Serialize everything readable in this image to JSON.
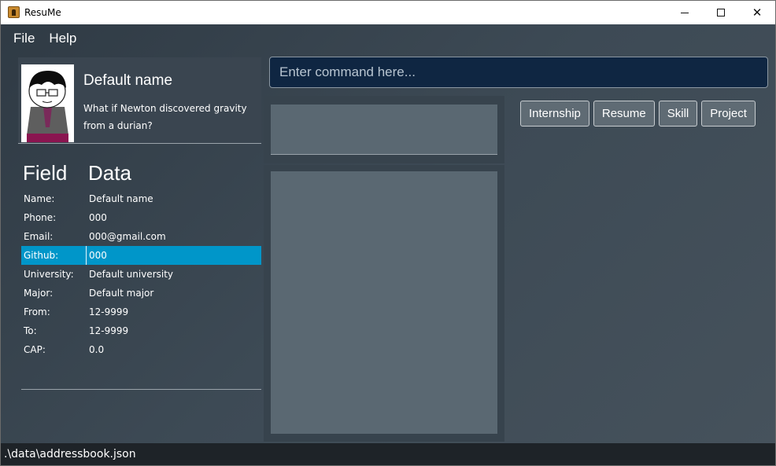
{
  "window": {
    "title": "ResuMe",
    "controls": {
      "minimize": "minimize",
      "maximize": "maximize",
      "close": "✕"
    }
  },
  "menu": {
    "items": [
      "File",
      "Help"
    ]
  },
  "profile": {
    "name": "Default name",
    "bio": "What if Newton discovered gravity from a durian?"
  },
  "fields": {
    "header_field": "Field",
    "header_data": "Data",
    "rows": [
      {
        "label": "Name:",
        "value": "Default name"
      },
      {
        "label": "Phone:",
        "value": "000"
      },
      {
        "label": "Email:",
        "value": "000@gmail.com"
      },
      {
        "label": "Github:",
        "value": "000"
      },
      {
        "label": "University:",
        "value": "Default university"
      },
      {
        "label": "Major:",
        "value": "Default major"
      },
      {
        "label": "From:",
        "value": "12-9999"
      },
      {
        "label": "To:",
        "value": "12-9999"
      },
      {
        "label": "CAP:",
        "value": "0.0"
      }
    ],
    "selected_index": 3
  },
  "command": {
    "placeholder": "Enter command here..."
  },
  "tabs": [
    "Internship",
    "Resume",
    "Skill",
    "Project"
  ],
  "status": {
    "path": ".\\data\\addressbook.json"
  },
  "colors": {
    "accent_selected": "#0096c9",
    "command_bg": "#0f2642",
    "panel_bg": "#5a6872",
    "status_bg": "#1e2328"
  }
}
